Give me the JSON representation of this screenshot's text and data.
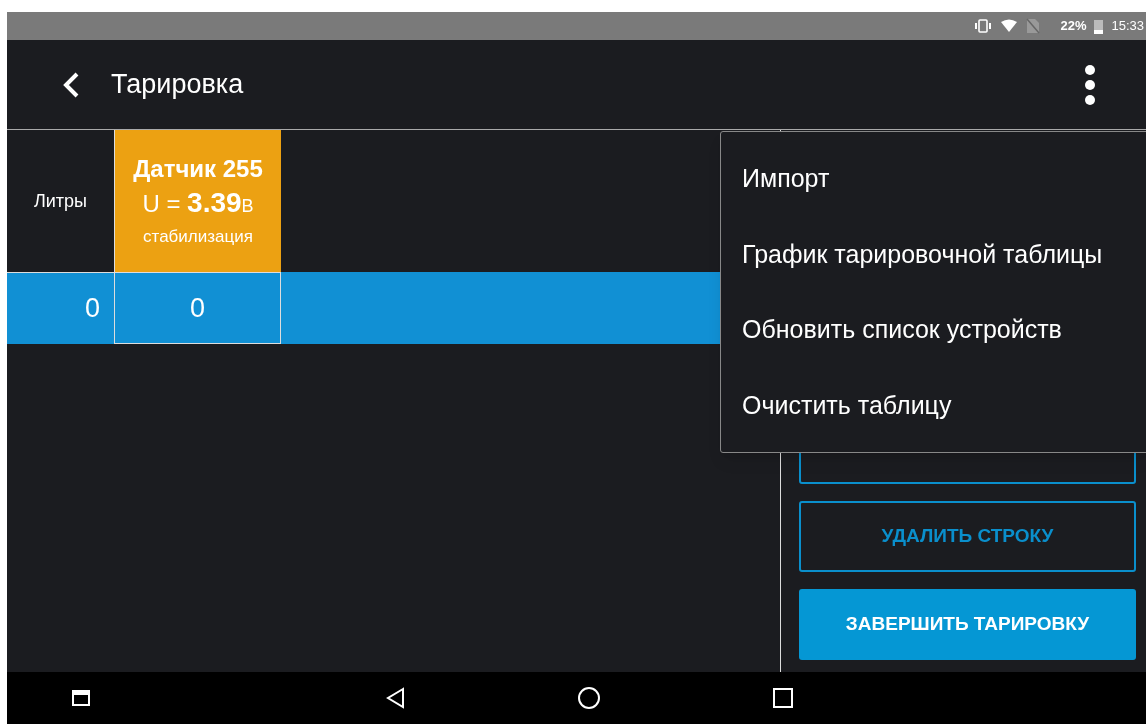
{
  "status_bar": {
    "battery": "22%",
    "time": "15:33"
  },
  "app_bar": {
    "title": "Тарировка"
  },
  "table": {
    "columns": [
      {
        "label": "Литры"
      },
      {
        "kind": "sensor",
        "title": "Датчик 255",
        "voltage_prefix": "U = ",
        "voltage": "3.39",
        "voltage_unit": "В",
        "state": "стабилизация"
      }
    ],
    "rows": [
      {
        "selected": true,
        "cells": [
          "0",
          "0"
        ]
      }
    ]
  },
  "buttons": [
    {
      "kind": "outline"
    },
    {
      "kind": "outline",
      "label": "УДАЛИТЬ СТРОКУ"
    },
    {
      "kind": "filled",
      "label": "ЗАВЕРШИТЬ ТАРИРОВКУ"
    }
  ],
  "menu": {
    "items": [
      "Импорт",
      "График тарировочной таблицы",
      "Обновить список устройств",
      "Очистить таблицу"
    ]
  }
}
